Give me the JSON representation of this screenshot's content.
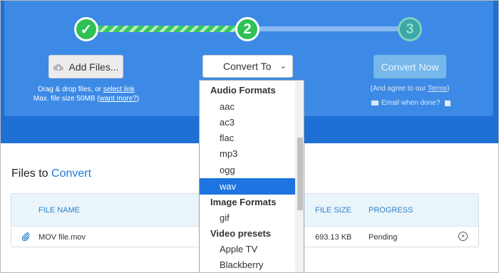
{
  "steps": [
    "✓",
    "2",
    "3"
  ],
  "add_files": {
    "label": "Add Files...",
    "hint_prefix": "Drag & drop files, or ",
    "select_link": "select link",
    "max_prefix": "Max. file size 50MB (",
    "want_more": "want more?",
    "max_suffix": ")"
  },
  "convert_to": {
    "label": "Convert To",
    "chevron": "⌄"
  },
  "convert_now": {
    "label": "Convert Now",
    "agree_prefix": "(And agree to our ",
    "terms": "Terms",
    "agree_suffix": ")",
    "email": "Email when done?"
  },
  "files": {
    "title_prefix": "Files to ",
    "title_accent": "Convert",
    "columns": {
      "name": "FILE NAME",
      "size": "FILE SIZE",
      "progress": "PROGRESS"
    },
    "rows": [
      {
        "name": "MOV file.mov",
        "size": "693.13 KB",
        "progress": "Pending"
      }
    ]
  },
  "dropdown": {
    "audio_group": "Audio Formats",
    "audio": [
      "aac",
      "ac3",
      "flac",
      "mp3",
      "ogg",
      "wav"
    ],
    "image_group": "Image Formats",
    "image": [
      "gif"
    ],
    "video_group": "Video presets",
    "video": [
      "Apple TV",
      "Blackberry"
    ],
    "selected": "wav"
  },
  "colors": {
    "brand_blue": "#1e6fd6",
    "step_green": "#2fc154",
    "selected_blue": "#1e74e0",
    "link_blue": "#1d7ad8"
  }
}
